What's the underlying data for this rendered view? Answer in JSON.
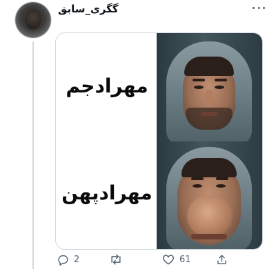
{
  "tweet": {
    "username": "گگری_سابق"
  },
  "media": {
    "top_label": "مهرادجم",
    "bottom_label": "مهرادپهن"
  },
  "actions": {
    "reply_count": "2",
    "retweet_count": "",
    "like_count": "61",
    "icons": [
      "reply-icon",
      "retweet-icon",
      "like-icon",
      "share-icon"
    ]
  },
  "colors": {
    "thread_line": "#cfd9de",
    "action_gray": "#536471",
    "border": "#cfd9de"
  }
}
